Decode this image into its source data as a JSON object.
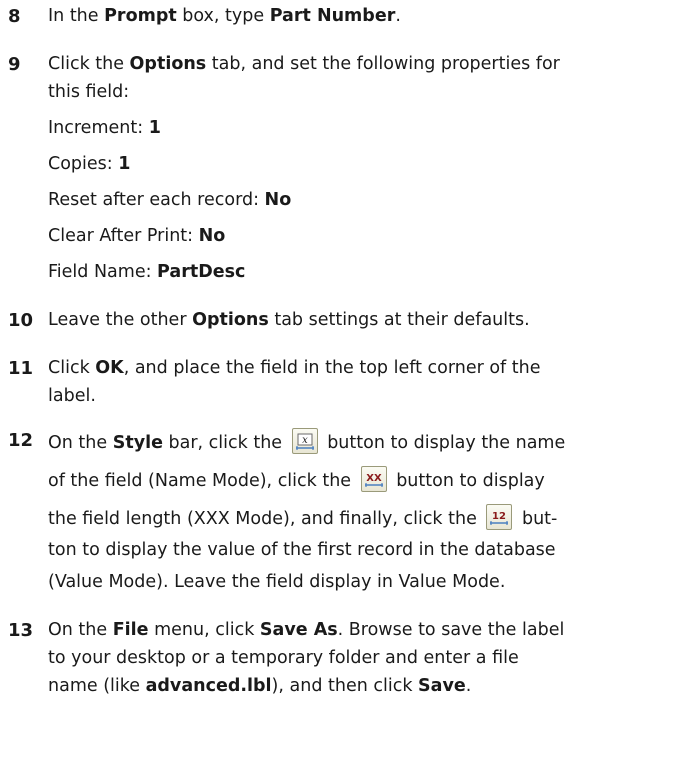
{
  "steps": {
    "s8": {
      "num": "8",
      "t1": "In the ",
      "b1": "Prompt",
      "t2": " box, type ",
      "b2": "Part Number",
      "t3": "."
    },
    "s9": {
      "num": "9",
      "l1": {
        "t1": "Click the ",
        "b1": "Options",
        "t2": " tab, and set the following properties for"
      },
      "l2": "this field:",
      "props": [
        {
          "label": "Increment: ",
          "value": "1"
        },
        {
          "label": "Copies: ",
          "value": "1"
        },
        {
          "label": "Reset after each record: ",
          "value": "No"
        },
        {
          "label": "Clear After Print: ",
          "value": "No"
        },
        {
          "label": "Field Name: ",
          "value": "PartDesc"
        }
      ]
    },
    "s10": {
      "num": "10",
      "t1": "Leave the other ",
      "b1": "Options",
      "t2": " tab settings at their defaults."
    },
    "s11": {
      "num": "11",
      "l1": {
        "t1": "Click ",
        "b1": "OK",
        "t2": ", and place the field in the top left corner of the"
      },
      "l2": "label."
    },
    "s12": {
      "num": "12",
      "l1": {
        "t1": "On the ",
        "b1": "Style",
        "t2": " bar, click the ",
        "t3": " button to display the name"
      },
      "l2": {
        "t1": "of the field (Name Mode), click the ",
        "t2": " button to display"
      },
      "l3": {
        "t1": "the field length (XXX Mode), and finally, click the ",
        "t2": " but-"
      },
      "l4": "ton to display the value of the first record in the database",
      "l5": "(Value Mode). Leave the field display in Value Mode."
    },
    "s13": {
      "num": "13",
      "l1": {
        "t1": "On the ",
        "b1": "File",
        "t2": " menu, click ",
        "b2": "Save As",
        "t3": ". Browse to save the label"
      },
      "l2": "to your desktop or a temporary folder and enter a file",
      "l3": {
        "t1": "name (like ",
        "b1": "advanced.lbl",
        "t2": "), and then click ",
        "b2": "Save",
        "t3": "."
      }
    }
  },
  "icons": {
    "name_mode": "name-mode-icon",
    "xxx_mode": "xxx-mode-icon",
    "value_mode": "value-mode-icon"
  }
}
